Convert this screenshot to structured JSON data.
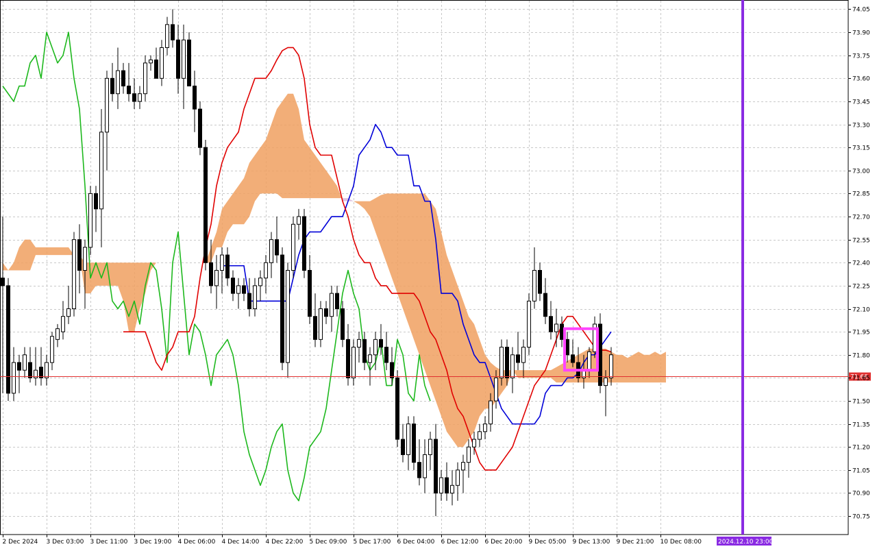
{
  "chart_data": {
    "type": "candlestick",
    "indicator": "Ichimoku Kinko Hyo",
    "y_axis": {
      "ticks": [
        74.05,
        73.9,
        73.75,
        73.6,
        73.45,
        73.3,
        73.15,
        73.0,
        72.85,
        72.7,
        72.55,
        72.4,
        72.25,
        72.1,
        71.95,
        71.8,
        71.65,
        71.5,
        71.35,
        71.2,
        71.05,
        70.9,
        70.75
      ],
      "tick_labels": [
        "74.05",
        "73.90",
        "73.75",
        "73.60",
        "73.45",
        "73.30",
        "73.15",
        "73.00",
        "72.85",
        "72.70",
        "72.55",
        "72.40",
        "72.25",
        "72.10",
        "71.95",
        "71.80",
        "71.65",
        "71.50",
        "71.35",
        "71.20",
        "71.05",
        "70.90",
        "70.75"
      ],
      "range": [
        70.63,
        74.11
      ]
    },
    "x_axis": {
      "tick_labels": [
        "2 Dec 2024",
        "3 Dec 03:00",
        "3 Dec 11:00",
        "3 Dec 19:00",
        "4 Dec 06:00",
        "4 Dec 14:00",
        "4 Dec 22:00",
        "5 Dec 09:00",
        "5 Dec 17:00",
        "6 Dec 04:00",
        "6 Dec 12:00",
        "6 Dec 20:00",
        "9 Dec 05:00",
        "9 Dec 13:00",
        "9 Dec 21:00",
        "10 Dec 08:00"
      ],
      "tick_bar_index": [
        0,
        8,
        16,
        24,
        32,
        40,
        48,
        56,
        64,
        72,
        80,
        88,
        96,
        104,
        112,
        120
      ],
      "period_separator_label": "2024.12.10 23:00",
      "period_separator_bar": 135
    },
    "current_price": 71.66,
    "current_price_label": "71.66",
    "colors": {
      "tenkan": "#e00000",
      "kijun": "#0000d8",
      "chikou": "#1db81d",
      "kumo_bull": "#f0a060",
      "kumo_bear": "#d8b8dc",
      "price_line": "#e03030",
      "separator": "#8a2be2",
      "highlight": "#ff44ff",
      "bull_candle": "#ffffff",
      "bear_candle": "#000000"
    },
    "candles": [
      [
        72.3,
        72.7,
        71.55,
        72.25
      ],
      [
        72.25,
        72.3,
        71.5,
        71.55
      ],
      [
        71.55,
        71.85,
        71.5,
        71.75
      ],
      [
        71.75,
        71.8,
        71.55,
        71.7
      ],
      [
        71.7,
        71.85,
        71.65,
        71.8
      ],
      [
        71.75,
        71.85,
        71.62,
        71.65
      ],
      [
        71.65,
        71.85,
        71.6,
        71.7
      ],
      [
        71.72,
        71.85,
        71.6,
        71.65
      ],
      [
        71.65,
        71.8,
        71.6,
        71.75
      ],
      [
        71.75,
        71.95,
        71.7,
        71.92
      ],
      [
        71.9,
        72.0,
        71.85,
        71.97
      ],
      [
        71.95,
        72.15,
        71.9,
        72.05
      ],
      [
        72.05,
        72.25,
        72.0,
        72.1
      ],
      [
        72.1,
        72.6,
        72.05,
        72.55
      ],
      [
        72.55,
        72.65,
        72.2,
        72.35
      ],
      [
        72.35,
        72.55,
        72.1,
        72.5
      ],
      [
        72.5,
        72.9,
        72.45,
        72.85
      ],
      [
        72.85,
        72.9,
        72.6,
        72.75
      ],
      [
        72.75,
        73.4,
        72.5,
        73.25
      ],
      [
        73.25,
        73.65,
        73.0,
        73.6
      ],
      [
        73.6,
        73.7,
        73.45,
        73.5
      ],
      [
        73.5,
        73.8,
        73.4,
        73.65
      ],
      [
        73.65,
        73.7,
        73.5,
        73.55
      ],
      [
        73.55,
        73.7,
        73.45,
        73.5
      ],
      [
        73.5,
        73.6,
        73.4,
        73.45
      ],
      [
        73.45,
        73.55,
        73.4,
        73.5
      ],
      [
        73.5,
        73.75,
        73.45,
        73.7
      ],
      [
        73.7,
        73.75,
        73.65,
        73.72
      ],
      [
        73.72,
        73.8,
        73.6,
        73.6
      ],
      [
        73.6,
        73.85,
        73.55,
        73.8
      ],
      [
        73.8,
        74.0,
        73.75,
        73.95
      ],
      [
        73.95,
        74.05,
        73.8,
        73.85
      ],
      [
        73.85,
        73.95,
        73.5,
        73.6
      ],
      [
        73.6,
        73.95,
        73.4,
        73.85
      ],
      [
        73.85,
        73.9,
        73.55,
        73.55
      ],
      [
        73.55,
        73.65,
        73.25,
        73.4
      ],
      [
        73.4,
        73.45,
        73.1,
        73.15
      ],
      [
        73.15,
        73.2,
        72.35,
        72.4
      ],
      [
        72.4,
        72.55,
        72.2,
        72.25
      ],
      [
        72.25,
        72.45,
        72.1,
        72.35
      ],
      [
        72.35,
        72.5,
        72.2,
        72.45
      ],
      [
        72.45,
        72.5,
        72.25,
        72.3
      ],
      [
        72.3,
        72.35,
        72.15,
        72.2
      ],
      [
        72.2,
        72.3,
        72.1,
        72.25
      ],
      [
        72.25,
        72.3,
        72.15,
        72.2
      ],
      [
        72.2,
        72.3,
        72.05,
        72.1
      ],
      [
        72.1,
        72.3,
        72.05,
        72.25
      ],
      [
        72.25,
        72.35,
        72.15,
        72.3
      ],
      [
        72.3,
        72.45,
        72.2,
        72.4
      ],
      [
        72.4,
        72.6,
        72.3,
        72.55
      ],
      [
        72.55,
        72.7,
        72.4,
        72.45
      ],
      [
        72.45,
        72.5,
        71.7,
        71.75
      ],
      [
        71.75,
        72.4,
        71.65,
        72.35
      ],
      [
        72.35,
        72.7,
        72.3,
        72.65
      ],
      [
        72.65,
        72.75,
        72.55,
        72.7
      ],
      [
        72.7,
        72.75,
        72.3,
        72.35
      ],
      [
        72.35,
        72.45,
        72.0,
        72.05
      ],
      [
        72.05,
        72.2,
        71.85,
        71.9
      ],
      [
        71.9,
        72.15,
        71.85,
        72.1
      ],
      [
        72.1,
        72.15,
        72.0,
        72.05
      ],
      [
        72.05,
        72.25,
        71.95,
        72.2
      ],
      [
        72.2,
        72.25,
        72.05,
        72.1
      ],
      [
        72.1,
        72.15,
        71.85,
        71.9
      ],
      [
        71.9,
        72.0,
        71.6,
        71.65
      ],
      [
        71.65,
        71.9,
        71.6,
        71.85
      ],
      [
        71.85,
        71.95,
        71.75,
        71.9
      ],
      [
        71.9,
        71.95,
        71.7,
        71.75
      ],
      [
        71.75,
        71.85,
        71.6,
        71.8
      ],
      [
        71.8,
        71.95,
        71.7,
        71.9
      ],
      [
        71.9,
        72.0,
        71.8,
        71.85
      ],
      [
        71.85,
        71.95,
        71.7,
        71.75
      ],
      [
        71.75,
        71.85,
        71.6,
        71.65
      ],
      [
        71.65,
        71.7,
        71.2,
        71.25
      ],
      [
        71.25,
        71.35,
        71.1,
        71.15
      ],
      [
        71.15,
        71.4,
        71.05,
        71.35
      ],
      [
        71.35,
        71.4,
        71.05,
        71.1
      ],
      [
        71.1,
        71.25,
        70.95,
        71.0
      ],
      [
        71.0,
        71.25,
        70.9,
        71.15
      ],
      [
        71.15,
        71.3,
        71.05,
        71.25
      ],
      [
        71.25,
        71.35,
        70.75,
        70.9
      ],
      [
        70.9,
        71.05,
        70.85,
        71.0
      ],
      [
        71.0,
        71.1,
        70.85,
        70.9
      ],
      [
        70.9,
        71.05,
        70.82,
        70.95
      ],
      [
        70.95,
        71.1,
        70.85,
        71.05
      ],
      [
        71.05,
        71.15,
        70.9,
        71.1
      ],
      [
        71.1,
        71.25,
        71.0,
        71.2
      ],
      [
        71.2,
        71.3,
        71.15,
        71.25
      ],
      [
        71.25,
        71.35,
        71.2,
        71.3
      ],
      [
        71.3,
        71.4,
        71.25,
        71.35
      ],
      [
        71.35,
        71.55,
        71.3,
        71.5
      ],
      [
        71.5,
        71.7,
        71.45,
        71.65
      ],
      [
        71.65,
        71.9,
        71.6,
        71.85
      ],
      [
        71.85,
        71.9,
        71.6,
        71.65
      ],
      [
        71.65,
        71.85,
        71.55,
        71.8
      ],
      [
        71.8,
        71.95,
        71.7,
        71.75
      ],
      [
        71.75,
        71.9,
        71.65,
        71.85
      ],
      [
        71.85,
        72.2,
        71.8,
        72.15
      ],
      [
        72.15,
        72.5,
        72.1,
        72.35
      ],
      [
        72.35,
        72.4,
        72.15,
        72.2
      ],
      [
        72.2,
        72.3,
        72.0,
        72.05
      ],
      [
        72.05,
        72.15,
        71.9,
        71.95
      ],
      [
        71.95,
        72.1,
        71.85,
        72.0
      ],
      [
        72.0,
        72.05,
        71.85,
        71.9
      ],
      [
        71.9,
        71.95,
        71.75,
        71.8
      ],
      [
        71.8,
        71.9,
        71.72,
        71.75
      ],
      [
        71.75,
        71.85,
        71.62,
        71.65
      ],
      [
        71.65,
        71.8,
        71.58,
        71.7
      ],
      [
        71.7,
        71.85,
        71.65,
        71.82
      ],
      [
        71.82,
        72.05,
        71.78,
        72.0
      ],
      [
        72.0,
        72.07,
        71.55,
        71.6
      ],
      [
        71.6,
        71.7,
        71.4,
        71.65
      ],
      [
        71.65,
        71.85,
        71.6,
        71.8
      ]
    ],
    "tenkan": [
      71.95,
      71.95,
      71.95,
      71.95,
      71.95,
      71.85,
      71.75,
      71.7,
      71.8,
      71.85,
      71.95,
      71.95,
      71.95,
      72.05,
      72.3,
      72.5,
      72.65,
      72.9,
      73.05,
      73.15,
      73.2,
      73.25,
      73.4,
      73.5,
      73.6,
      73.6,
      73.6,
      73.65,
      73.72,
      73.78,
      73.8,
      73.8,
      73.75,
      73.6,
      73.3,
      73.15,
      73.1,
      73.1,
      73.1,
      72.95,
      72.8,
      72.7,
      72.55,
      72.45,
      72.4,
      72.4,
      72.3,
      72.25,
      72.25,
      72.2,
      72.2,
      72.2,
      72.2,
      72.2,
      72.15,
      72.05,
      71.95,
      71.9,
      71.8,
      71.7,
      71.55,
      71.45,
      71.4,
      71.3,
      71.2,
      71.1,
      71.05,
      71.05,
      71.05,
      71.1,
      71.15,
      71.2,
      71.3,
      71.4,
      71.5,
      71.6,
      71.65,
      71.7,
      71.8,
      71.9,
      72.0,
      72.05,
      72.05,
      72.0,
      71.95,
      71.9,
      71.85,
      71.83,
      71.83,
      71.82
    ],
    "kijun": [
      72.38,
      72.38,
      72.38,
      72.38,
      72.38,
      72.15,
      72.15,
      72.15,
      72.15,
      72.15,
      72.15,
      72.15,
      72.15,
      72.3,
      72.45,
      72.55,
      72.6,
      72.6,
      72.6,
      72.65,
      72.7,
      72.7,
      72.7,
      72.8,
      72.9,
      73.1,
      73.15,
      73.2,
      73.3,
      73.25,
      73.15,
      73.15,
      73.1,
      73.1,
      73.1,
      72.9,
      72.9,
      72.8,
      72.8,
      72.55,
      72.2,
      72.2,
      72.2,
      72.15,
      72.0,
      71.9,
      71.8,
      71.75,
      71.75,
      71.65,
      71.55,
      71.45,
      71.4,
      71.35,
      71.35,
      71.35,
      71.35,
      71.35,
      71.4,
      71.55,
      71.6,
      71.6,
      71.6,
      71.65,
      71.65,
      71.68,
      71.75,
      71.8,
      71.8,
      71.85,
      71.9,
      71.95
    ],
    "chikou": [
      73.55,
      73.5,
      73.45,
      73.55,
      73.55,
      73.7,
      73.75,
      73.6,
      73.9,
      73.8,
      73.7,
      73.75,
      73.9,
      73.6,
      73.4,
      72.9,
      72.3,
      72.4,
      72.3,
      72.4,
      72.15,
      72.1,
      72.15,
      72.05,
      72.15,
      72.0,
      72.25,
      72.4,
      72.35,
      72.1,
      71.75,
      72.4,
      72.6,
      72.2,
      71.8,
      72.0,
      71.95,
      71.8,
      71.6,
      71.8,
      71.85,
      71.9,
      71.8,
      71.6,
      71.3,
      71.15,
      71.05,
      70.95,
      71.05,
      71.2,
      71.3,
      71.35,
      71.05,
      70.9,
      70.85,
      71.0,
      71.2,
      71.25,
      71.3,
      71.45,
      71.7,
      71.95,
      72.2,
      72.35,
      72.2,
      72.1,
      71.8,
      71.7,
      71.75,
      71.9,
      71.6,
      71.6,
      71.9,
      71.8,
      71.55,
      71.5,
      71.8,
      71.6,
      71.5
    ],
    "senkou_a": [
      72.4,
      72.35,
      72.4,
      72.5,
      72.55,
      72.55,
      72.5,
      72.5,
      72.5,
      72.5,
      72.5,
      72.5,
      72.5,
      72.45,
      72.45,
      72.4,
      72.4,
      72.4,
      72.4,
      72.4,
      72.4,
      72.4,
      72.4,
      72.4,
      72.4,
      72.4,
      72.4,
      72.4,
      72.4,
      72.4,
      72.4,
      72.4,
      72.4,
      72.4,
      72.4,
      72.4,
      72.4,
      72.4,
      72.5,
      72.6,
      72.75,
      72.8,
      72.85,
      72.9,
      72.95,
      73.05,
      73.1,
      73.15,
      73.2,
      73.3,
      73.4,
      73.45,
      73.5,
      73.5,
      73.4,
      73.2,
      73.15,
      73.1,
      73.05,
      73.0,
      72.95,
      72.9,
      72.8,
      72.8,
      72.8,
      72.8,
      72.8,
      72.8,
      72.82,
      72.84,
      72.85,
      72.85,
      72.85,
      72.85,
      72.85,
      72.85,
      72.85,
      72.85,
      72.8,
      72.75,
      72.6,
      72.45,
      72.35,
      72.25,
      72.15,
      72.05,
      72.0,
      71.9,
      71.8,
      71.75,
      71.72,
      71.7,
      71.7,
      71.7,
      71.7,
      71.7,
      71.7,
      71.7,
      71.7,
      71.7,
      71.7,
      71.72,
      71.74,
      71.76,
      71.78,
      71.8,
      71.82,
      71.84,
      71.84,
      71.84,
      71.84,
      71.82,
      71.8,
      71.8,
      71.78,
      71.8,
      71.82,
      71.8,
      71.8,
      71.82,
      71.8,
      71.82
    ],
    "senkou_b": [
      72.35,
      72.35,
      72.35,
      72.35,
      72.35,
      72.35,
      72.45,
      72.45,
      72.45,
      72.45,
      72.45,
      72.45,
      72.45,
      72.45,
      72.45,
      72.2,
      72.2,
      72.25,
      72.25,
      72.25,
      72.25,
      72.25,
      72.15,
      71.95,
      71.95,
      72.1,
      72.2,
      72.35,
      72.4,
      72.4,
      72.4,
      72.4,
      72.4,
      72.4,
      72.4,
      72.4,
      72.4,
      72.4,
      72.4,
      72.5,
      72.5,
      72.6,
      72.65,
      72.65,
      72.65,
      72.7,
      72.8,
      72.85,
      72.85,
      72.85,
      72.85,
      72.82,
      72.82,
      72.82,
      72.82,
      72.82,
      72.82,
      72.82,
      72.82,
      72.82,
      72.82,
      72.82,
      72.82,
      72.82,
      72.8,
      72.78,
      72.75,
      72.7,
      72.6,
      72.5,
      72.4,
      72.3,
      72.2,
      72.1,
      72.0,
      71.9,
      71.8,
      71.7,
      71.6,
      71.5,
      71.4,
      71.3,
      71.25,
      71.2,
      71.2,
      71.25,
      71.3,
      71.4,
      71.45,
      71.45,
      71.5,
      71.55,
      71.6,
      71.7,
      71.65,
      71.65,
      71.65,
      71.65,
      71.65,
      71.65,
      71.65,
      71.62,
      71.62,
      71.62,
      71.62,
      71.62,
      71.62,
      71.62,
      71.62,
      71.62,
      71.62,
      71.62,
      71.62,
      71.62,
      71.62,
      71.62,
      71.62,
      71.62,
      71.62,
      71.62,
      71.62,
      71.62
    ]
  }
}
